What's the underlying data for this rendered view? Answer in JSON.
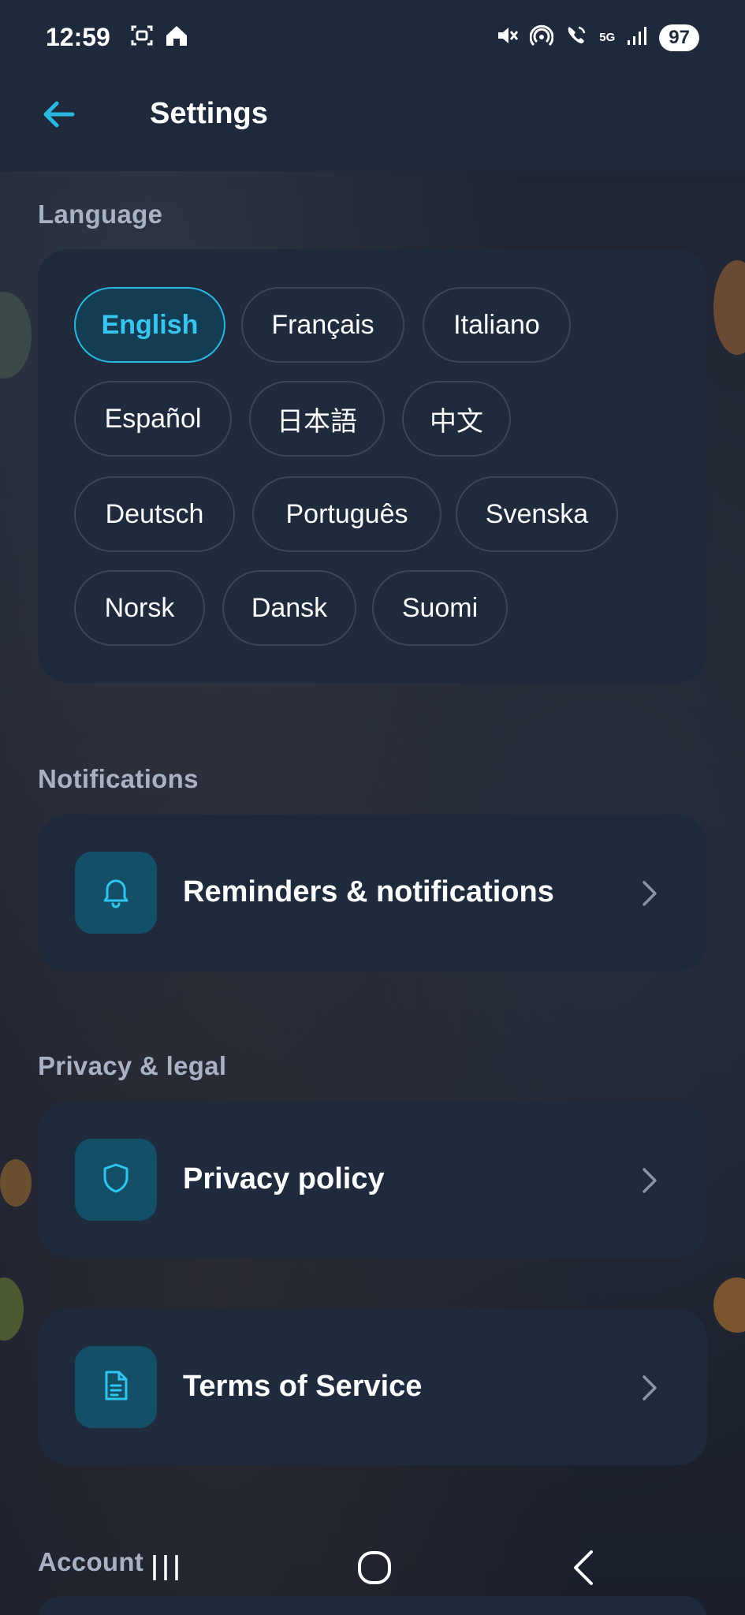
{
  "status_bar": {
    "time": "12:59",
    "network": "5G",
    "battery": "97",
    "icons": [
      "screenshot-icon",
      "home-app-icon",
      "mute-icon",
      "hotspot-icon",
      "wifi-call-icon",
      "signal-icon"
    ]
  },
  "header": {
    "title": "Settings",
    "back_icon": "arrow-left-icon"
  },
  "language": {
    "section_title": "Language",
    "options": [
      {
        "label": "English",
        "selected": true
      },
      {
        "label": "Français",
        "selected": false
      },
      {
        "label": "Italiano",
        "selected": false
      },
      {
        "label": "Español",
        "selected": false
      },
      {
        "label": "日本語",
        "selected": false
      },
      {
        "label": "中文",
        "selected": false
      },
      {
        "label": "Deutsch",
        "selected": false
      },
      {
        "label": "Português",
        "selected": false
      },
      {
        "label": "Svenska",
        "selected": false
      },
      {
        "label": "Norsk",
        "selected": false
      },
      {
        "label": "Dansk",
        "selected": false
      },
      {
        "label": "Suomi",
        "selected": false
      }
    ]
  },
  "notifications": {
    "section_title": "Notifications",
    "item": {
      "label": "Reminders & notifications",
      "icon": "bell-icon"
    }
  },
  "privacy": {
    "section_title": "Privacy & legal",
    "items": [
      {
        "label": "Privacy policy",
        "icon": "shield-icon"
      },
      {
        "label": "Terms of Service",
        "icon": "document-icon"
      }
    ]
  },
  "account": {
    "section_title": "Account"
  },
  "colors": {
    "accent": "#2ab8e0",
    "card": "#1f2a3c",
    "icon_box": "#135068",
    "header": "#1e2a3b"
  },
  "nav_bar": {
    "buttons": [
      "recents-icon",
      "home-icon",
      "back-icon"
    ]
  }
}
